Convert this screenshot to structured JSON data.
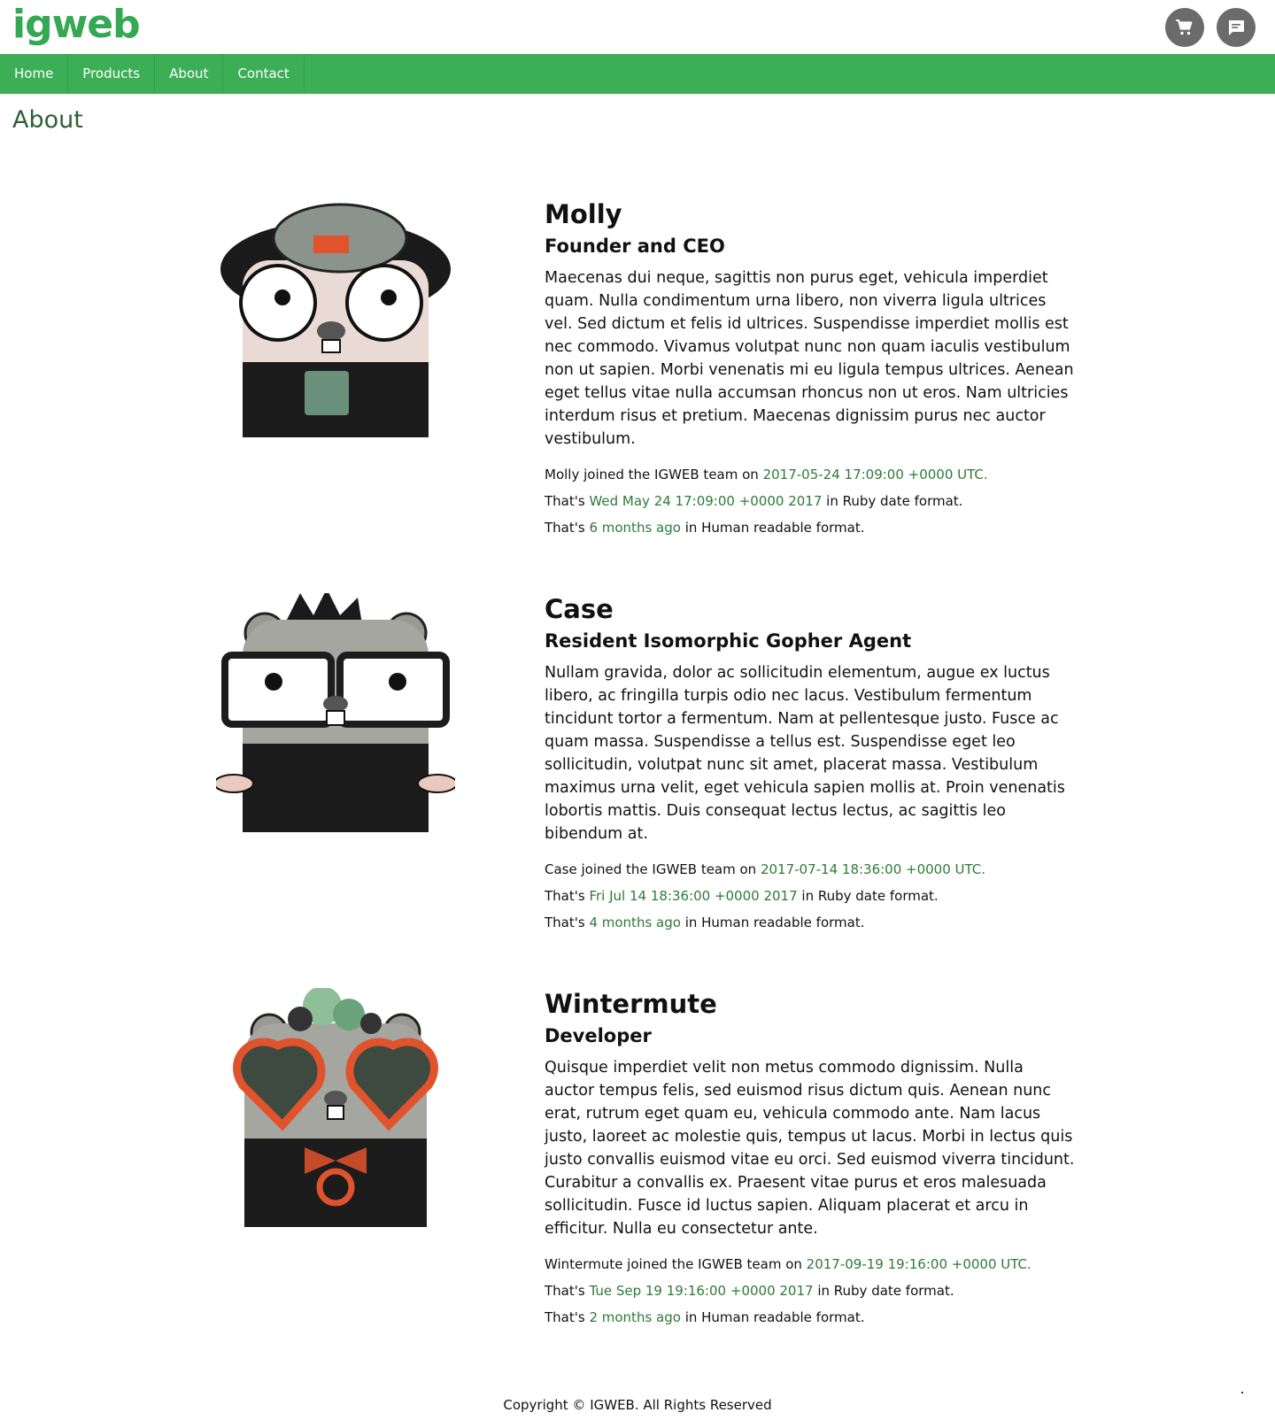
{
  "header": {
    "logo": "igweb",
    "cart_icon": "cart-icon",
    "chat_icon": "chat-icon"
  },
  "nav": {
    "items": [
      {
        "label": "Home"
      },
      {
        "label": "Products"
      },
      {
        "label": "About"
      },
      {
        "label": "Contact"
      }
    ]
  },
  "page": {
    "title": "About"
  },
  "members": [
    {
      "name": "Molly",
      "role": "Founder and CEO",
      "bio": "Maecenas dui neque, sagittis non purus eget, vehicula imperdiet quam. Nulla condimentum urna libero, non viverra ligula ultrices vel. Sed dictum et felis id ultrices. Suspendisse imperdiet mollis est nec commodo. Vivamus volutpat nunc non quam iaculis vestibulum non ut sapien. Morbi venenatis mi eu ligula tempus ultrices. Aenean eget tellus vitae nulla accumsan rhoncus non ut eros. Nam ultricies interdum risus et pretium. Maecenas dignissim purus nec auctor vestibulum.",
      "joined_prefix": "Molly joined the IGWEB team on ",
      "joined_date": "2017-05-24 17:09:00 +0000 UTC.",
      "ruby_prefix": "That's ",
      "ruby_date": "Wed May 24 17:09:00 +0000 2017",
      "ruby_suffix": " in Ruby date format.",
      "human_prefix": "That's ",
      "human_date": "6 months ago",
      "human_suffix": " in Human readable format."
    },
    {
      "name": "Case",
      "role": "Resident Isomorphic Gopher Agent",
      "bio": "Nullam gravida, dolor ac sollicitudin elementum, augue ex luctus libero, ac fringilla turpis odio nec lacus. Vestibulum fermentum tincidunt tortor a fermentum. Nam at pellentesque justo. Fusce ac quam massa. Suspendisse a tellus est. Suspendisse eget leo sollicitudin, volutpat nunc sit amet, placerat massa. Vestibulum maximus urna velit, eget vehicula sapien mollis at. Proin venenatis lobortis mattis. Duis consequat lectus lectus, ac sagittis leo bibendum at.",
      "joined_prefix": "Case joined the IGWEB team on ",
      "joined_date": "2017-07-14 18:36:00 +0000 UTC.",
      "ruby_prefix": "That's ",
      "ruby_date": "Fri Jul 14 18:36:00 +0000 2017",
      "ruby_suffix": " in Ruby date format.",
      "human_prefix": "That's ",
      "human_date": "4 months ago",
      "human_suffix": " in Human readable format."
    },
    {
      "name": "Wintermute",
      "role": "Developer",
      "bio": "Quisque imperdiet velit non metus commodo dignissim. Nulla auctor tempus felis, sed euismod risus dictum quis. Aenean nunc erat, rutrum eget quam eu, vehicula commodo ante. Nam lacus justo, laoreet ac molestie quis, tempus ut lacus. Morbi in lectus quis justo convallis euismod vitae eu orci. Sed euismod viverra tincidunt. Curabitur a convallis ex. Praesent vitae purus et eros malesuada sollicitudin. Fusce id luctus sapien. Aliquam placerat et arcu in efficitur. Nulla eu consectetur ante.",
      "joined_prefix": "Wintermute joined the IGWEB team on ",
      "joined_date": "2017-09-19 19:16:00 +0000 UTC.",
      "ruby_prefix": "That's ",
      "ruby_date": "Tue Sep 19 19:16:00 +0000 2017",
      "ruby_suffix": " in Ruby date format.",
      "human_prefix": "That's ",
      "human_date": "2 months ago",
      "human_suffix": " in Human readable format."
    }
  ],
  "footer": {
    "copyright": "Copyright © IGWEB. All Rights Reserved"
  },
  "colors": {
    "brand": "#34a853",
    "nav_bg": "#3caf56",
    "title": "#2f5f38",
    "link": "#2e7a38"
  }
}
